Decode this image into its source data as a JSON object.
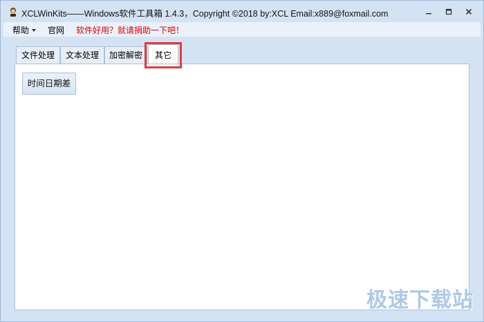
{
  "window": {
    "title": "XCLWinKits——Windows软件工具箱    1.4.3，Copyright ©2018 by:XCL Email:x889@foxmail.com"
  },
  "menu": {
    "help": "帮助",
    "website": "官网",
    "donate": "软件好用？就请捐助一下吧！"
  },
  "tabs": [
    {
      "label": "文件处理"
    },
    {
      "label": "文本处理"
    },
    {
      "label": "加密解密"
    },
    {
      "label": "其它",
      "active": true
    }
  ],
  "panel": {
    "button_label": "时间日期差"
  },
  "watermark": "极速下载站"
}
